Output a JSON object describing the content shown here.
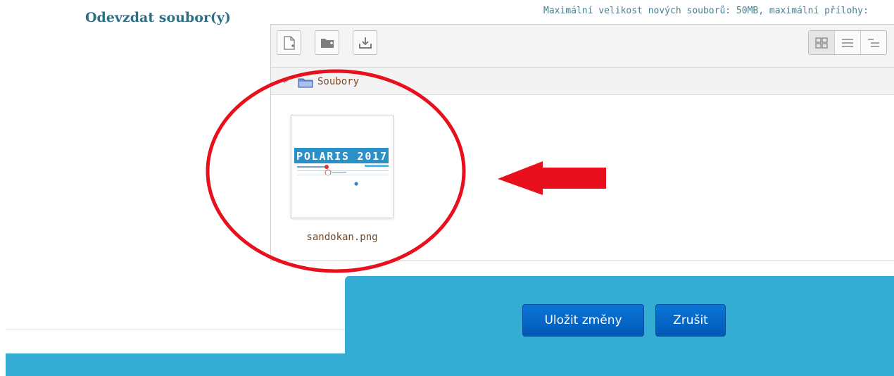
{
  "section_label": "Odevzdat soubor(y)",
  "max_info": "Maximální velikost nových souborů: 50MB, maximální přílohy:",
  "toolbar": {
    "add_file_icon": "add-file-icon",
    "create_folder_icon": "create-folder-icon",
    "download_icon": "download-icon",
    "views": [
      "thumbnail-view-icon",
      "list-view-icon",
      "tree-view-icon"
    ]
  },
  "path": {
    "folder_label": "Soubory"
  },
  "files": [
    {
      "name": "sandokan.png",
      "thumbnail_text": "POLARIS 2017"
    }
  ],
  "buttons": {
    "save": "Uložit změny",
    "cancel": "Zrušit"
  },
  "colors": {
    "accent": "#35acd3",
    "button": "#0a6fd0",
    "annotation": "#e8101c",
    "label": "#2d6f86"
  }
}
